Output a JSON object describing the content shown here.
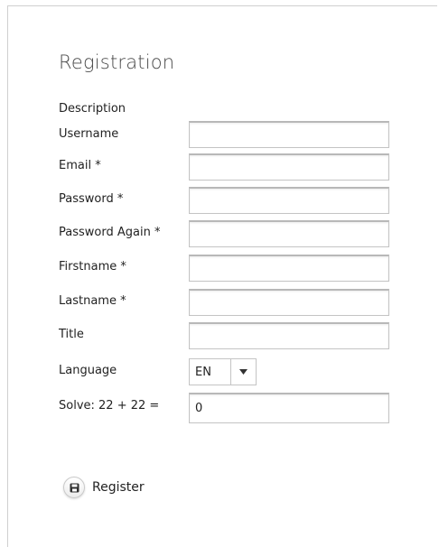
{
  "form": {
    "title": "Registration",
    "description": "Description",
    "fields": [
      {
        "label": "Username",
        "value": ""
      },
      {
        "label": "Email *",
        "value": ""
      },
      {
        "label": "Password *",
        "value": ""
      },
      {
        "label": "Password Again *",
        "value": ""
      },
      {
        "label": "Firstname *",
        "value": ""
      },
      {
        "label": "Lastname *",
        "value": ""
      },
      {
        "label": "Title",
        "value": ""
      }
    ],
    "language": {
      "label": "Language",
      "selected": "EN"
    },
    "captcha": {
      "label": "Solve: 22 + 22 =",
      "value": "0"
    },
    "register_label": "Register"
  },
  "icons": {
    "register": "save-icon",
    "dropdown": "caret-down-icon"
  }
}
